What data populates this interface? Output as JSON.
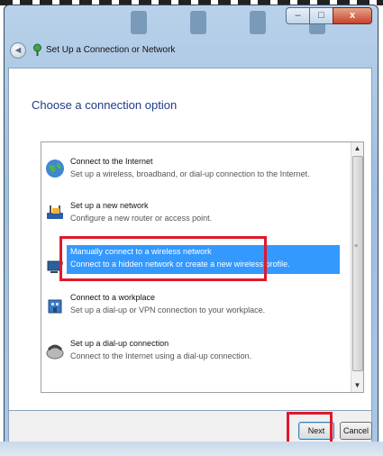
{
  "window": {
    "title": "Set Up a Connection or Network",
    "minimize_glyph": "–",
    "maximize_glyph": "□",
    "close_glyph": "x",
    "back_glyph": "◄"
  },
  "main": {
    "heading": "Choose a connection option",
    "options": [
      {
        "title": "Connect to the Internet",
        "description": "Set up a wireless, broadband, or dial-up connection to the Internet.",
        "icon": "globe-icon",
        "selected": false
      },
      {
        "title": "Set up a new network",
        "description": "Configure a new router or access point.",
        "icon": "router-icon",
        "selected": false
      },
      {
        "title": "Manually connect to a wireless network",
        "description": "Connect to a hidden network or create a new wireless profile.",
        "icon": "wireless-computer-icon",
        "selected": true
      },
      {
        "title": "Connect to a workplace",
        "description": "Set up a dial-up or VPN connection to your workplace.",
        "icon": "workplace-icon",
        "selected": false
      },
      {
        "title": "Set up a dial-up connection",
        "description": "Connect to the Internet using a dial-up connection.",
        "icon": "phone-modem-icon",
        "selected": false
      }
    ]
  },
  "footer": {
    "next_label": "Next",
    "cancel_label": "Cancel"
  },
  "colors": {
    "selection": "#3399ff",
    "highlight_box": "#e0182b"
  }
}
